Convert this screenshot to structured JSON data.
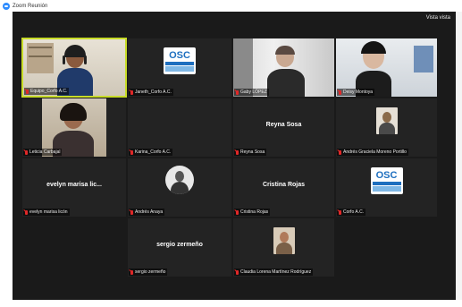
{
  "window": {
    "title": "Zoom Reunión"
  },
  "toolbar": {
    "view_label": "Vista vista"
  },
  "participants": [
    {
      "name": "Equipo_Corfo A.C.",
      "type": "video",
      "active": true
    },
    {
      "name": "Janeth_Corfo A.C.",
      "type": "logo"
    },
    {
      "name": "Gaby LÓPEZ",
      "type": "video"
    },
    {
      "name": "Deisy Montoya",
      "type": "video"
    },
    {
      "name": "Leticia Carbajal",
      "type": "video"
    },
    {
      "name": "Karina_Corfo A.C.",
      "type": "blank"
    },
    {
      "name": "Reyna Sosa",
      "type": "name",
      "display": "Reyna Sosa"
    },
    {
      "name": "Andrés Graciela Moreno Portillo",
      "type": "photo"
    },
    {
      "name": "evelyn marisa licón",
      "type": "name",
      "display": "evelyn marisa lic..."
    },
    {
      "name": "Andrés Anaya",
      "type": "avatar"
    },
    {
      "name": "Cristina Rojas",
      "type": "name",
      "display": "Cristina Rojas"
    },
    {
      "name": "Corfo A.C.",
      "type": "logo"
    },
    {
      "name": "",
      "type": "empty"
    },
    {
      "name": "sergio zermeño",
      "type": "name",
      "display": "sergio zermeño"
    },
    {
      "name": "Claudia Lorena Martínez Rodríguez",
      "type": "photo"
    }
  ],
  "logo": {
    "text": "OSC",
    "subtitle": "ANALIZADAS"
  },
  "colors": {
    "meeting_bg": "#1a1a1a",
    "tile_bg": "#232323",
    "active_border": "#c8dc28",
    "muted_mic": "#e02828",
    "brand_blue": "#2d8cff"
  },
  "icons": [
    "zoom-app-icon",
    "muted-mic-icon"
  ]
}
